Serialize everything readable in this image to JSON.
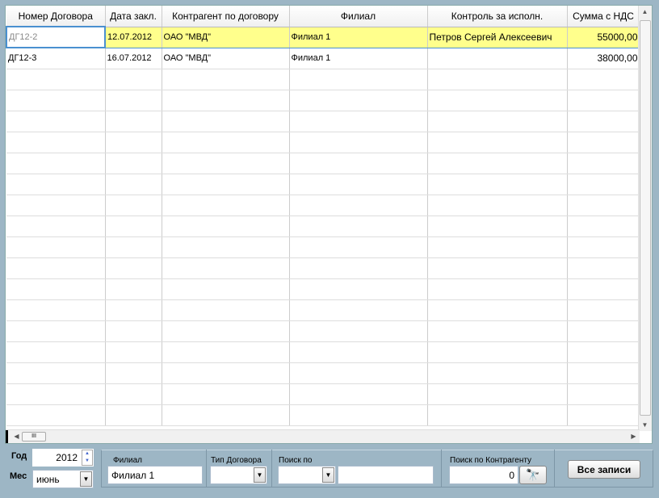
{
  "table": {
    "columns": [
      "Номер Договора",
      "Дата закл.",
      "Контрагент по договору",
      "Филиал",
      "Контроль за исполн.",
      "Сумма с НДС"
    ],
    "rows": [
      [
        "ДГ12-2",
        "12.07.2012",
        "ОАО \"МВД\"",
        "Филиал 1",
        "Петров Сергей Алексеевич",
        "55000,00"
      ],
      [
        "ДГ12-3",
        "16.07.2012",
        "ОАО \"МВД\"",
        "Филиал 1",
        "",
        "38000,00"
      ]
    ],
    "selected_row": 0
  },
  "filters": {
    "year_label": "Год",
    "year_value": "2012",
    "month_label": "Мес",
    "month_value": "июнь",
    "branch_label": "Филиал",
    "branch_value": "Филиал 1",
    "contract_type_label": "Тип Договора",
    "contract_type_value": "",
    "search_by_label": "Поиск по",
    "search_by_value": "",
    "search_text": "",
    "counterparty_search_label": "Поиск по Контрагенту",
    "counterparty_search_value": "0",
    "all_records_label": "Все записи"
  }
}
